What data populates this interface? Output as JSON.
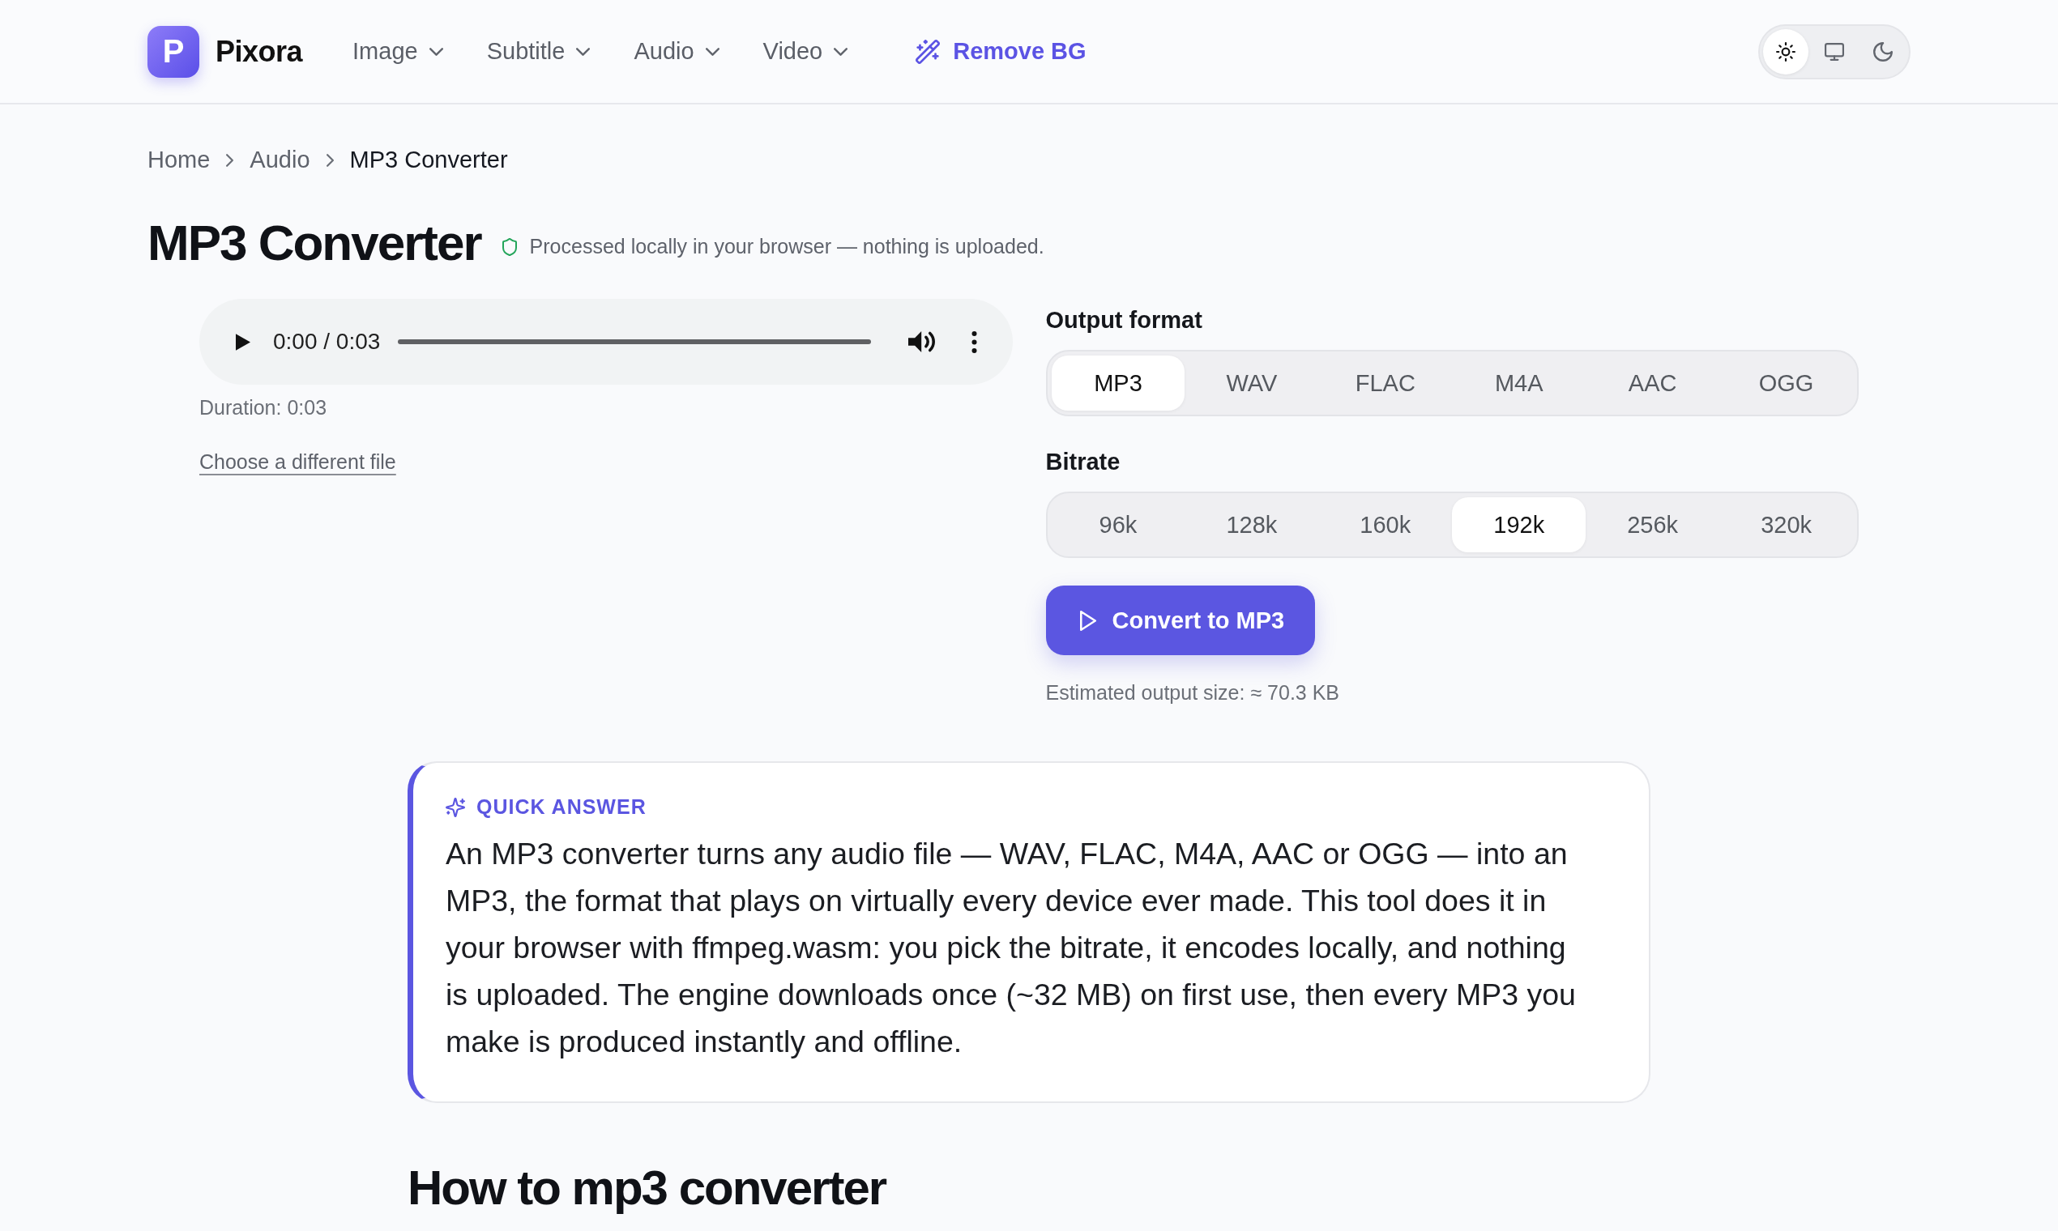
{
  "header": {
    "logo": {
      "letter": "P",
      "name": "Pixora"
    },
    "nav": [
      {
        "label": "Image",
        "kind": "menu"
      },
      {
        "label": "Subtitle",
        "kind": "menu"
      },
      {
        "label": "Audio",
        "kind": "menu"
      },
      {
        "label": "Video",
        "kind": "menu"
      },
      {
        "label": "Remove BG",
        "kind": "feature"
      }
    ],
    "theme_toggle": [
      {
        "kind": "light",
        "selected": true
      },
      {
        "kind": "system",
        "selected": false
      },
      {
        "kind": "dark",
        "selected": false
      }
    ]
  },
  "breadcrumb": [
    {
      "label": "Home",
      "current": false
    },
    {
      "label": "Audio",
      "current": false
    },
    {
      "label": "MP3 Converter",
      "current": true
    }
  ],
  "title": "MP3 Converter",
  "privacy_note": "Processed locally in your browser — nothing is uploaded.",
  "player": {
    "time": "0:00 / 0:03"
  },
  "duration": "Duration: 0:03",
  "change_file_link": "Choose a different file",
  "output_format": {
    "label": "Output format",
    "options": [
      {
        "label": "MP3",
        "selected": true
      },
      {
        "label": "WAV",
        "selected": false
      },
      {
        "label": "FLAC",
        "selected": false
      },
      {
        "label": "M4A",
        "selected": false
      },
      {
        "label": "AAC",
        "selected": false
      },
      {
        "label": "OGG",
        "selected": false
      }
    ]
  },
  "bitrate": {
    "label": "Bitrate",
    "options": [
      {
        "label": "96k",
        "selected": false
      },
      {
        "label": "128k",
        "selected": false
      },
      {
        "label": "160k",
        "selected": false
      },
      {
        "label": "192k",
        "selected": true
      },
      {
        "label": "256k",
        "selected": false
      },
      {
        "label": "320k",
        "selected": false
      }
    ]
  },
  "convert_button": "Convert to MP3",
  "estimate": "Estimated output size: ≈ 70.3 KB",
  "quick_answer": {
    "label": "QUICK ANSWER",
    "text": "An MP3 converter turns any audio file — WAV, FLAC, M4A, AAC or OGG — into an MP3, the format that plays on virtually every device ever made. This tool does it in your browser with ffmpeg.wasm: you pick the bitrate, it encodes locally, and nothing is uploaded. The engine downloads once (~32 MB) on first use, then every MP3 you make is produced instantly and offline."
  },
  "section_heading": "How to mp3 converter"
}
